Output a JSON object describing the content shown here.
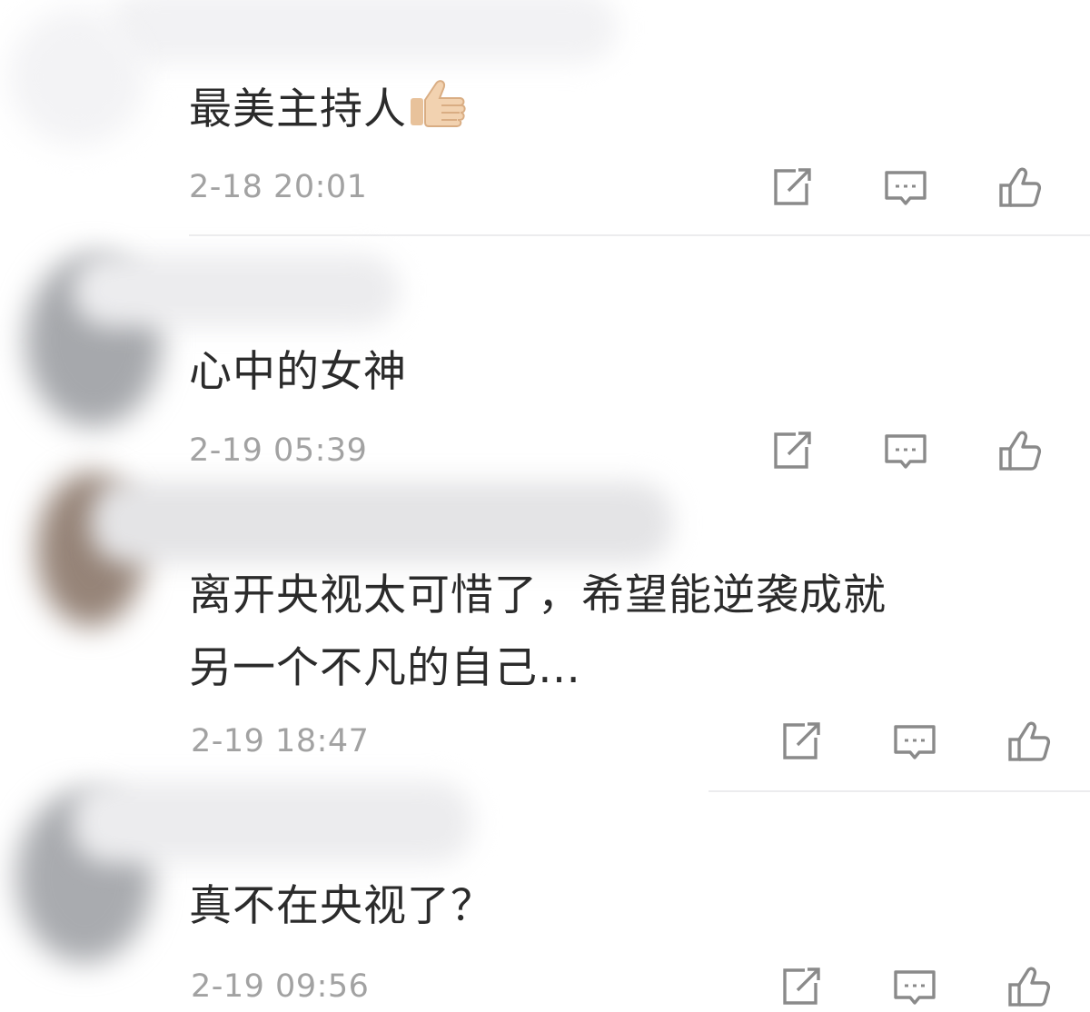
{
  "comments": [
    {
      "text": "最美主持人",
      "emoji_name": "thumbs-up-emoji",
      "timestamp": "2-18 20:01"
    },
    {
      "text": "心中的女神",
      "timestamp": "2-19 05:39"
    },
    {
      "text_line1": "离开央视太可惜了，希望能逆袭成就",
      "text_line2": "另一个不凡的自己…",
      "timestamp": "2-19 18:47"
    },
    {
      "text": "真不在央视了？",
      "timestamp": "2-19 09:56"
    }
  ],
  "actions": {
    "share_icon": "share-icon",
    "reply_icon": "comment-icon",
    "like_icon": "like-icon"
  },
  "colors": {
    "text": "#2b2b2b",
    "timestamp": "#a2a2a2",
    "icon": "#8a8a8a",
    "divider": "#ececee"
  }
}
